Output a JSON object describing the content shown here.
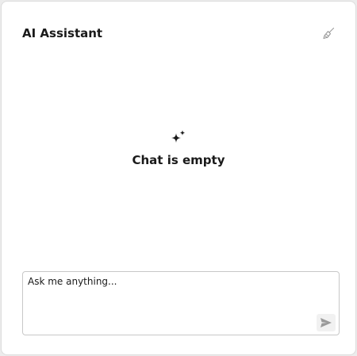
{
  "header": {
    "title": "AI Assistant",
    "clear_icon": "broom-icon"
  },
  "empty_state": {
    "icon": "sparkle-icon",
    "text": "Chat is empty"
  },
  "composer": {
    "placeholder": "Ask me anything...",
    "value": "",
    "send_icon": "send-icon"
  },
  "colors": {
    "text": "#1a1a1a",
    "border": "#c8c8c8",
    "icon_muted": "#9a9a9a"
  }
}
